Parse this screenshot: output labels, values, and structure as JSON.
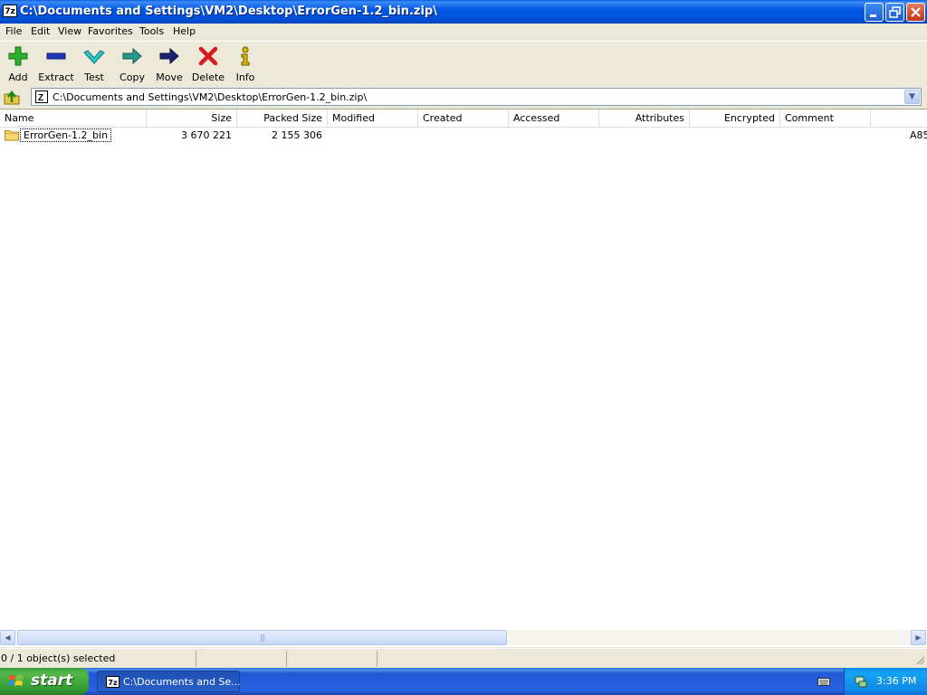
{
  "window": {
    "app_icon_text": "7z",
    "title": "C:\\Documents and Settings\\VM2\\Desktop\\ErrorGen-1.2_bin.zip\\"
  },
  "menu": [
    "File",
    "Edit",
    "View",
    "Favorites",
    "Tools",
    "Help"
  ],
  "toolbar": [
    {
      "label": "Add",
      "icon": "plus-icon"
    },
    {
      "label": "Extract",
      "icon": "minus-icon"
    },
    {
      "label": "Test",
      "icon": "check-icon"
    },
    {
      "label": "Copy",
      "icon": "arrow-right-teal-icon"
    },
    {
      "label": "Move",
      "icon": "arrow-right-blue-icon"
    },
    {
      "label": "Delete",
      "icon": "x-red-icon"
    },
    {
      "label": "Info",
      "icon": "info-icon"
    }
  ],
  "address": {
    "path": "C:\\Documents and Settings\\VM2\\Desktop\\ErrorGen-1.2_bin.zip\\"
  },
  "columns": [
    "Name",
    "Size",
    "Packed Size",
    "Modified",
    "Created",
    "Accessed",
    "Attributes",
    "Encrypted",
    "Comment"
  ],
  "rows": [
    {
      "name": "ErrorGen-1.2_bin",
      "size": "3 670 221",
      "packed": "2 155 306",
      "overflow": "A85"
    }
  ],
  "status": {
    "selection": "0 / 1 object(s) selected"
  },
  "taskbar": {
    "start_label": "start",
    "task_label": "C:\\Documents and Se...",
    "task_icon_text": "7z",
    "clock": "3:36 PM"
  },
  "colors": {
    "titlebar": "#0058e6",
    "start_green": "#37a037",
    "taskbar_blue": "#2663e0",
    "tray_blue": "#0f8ae9"
  }
}
